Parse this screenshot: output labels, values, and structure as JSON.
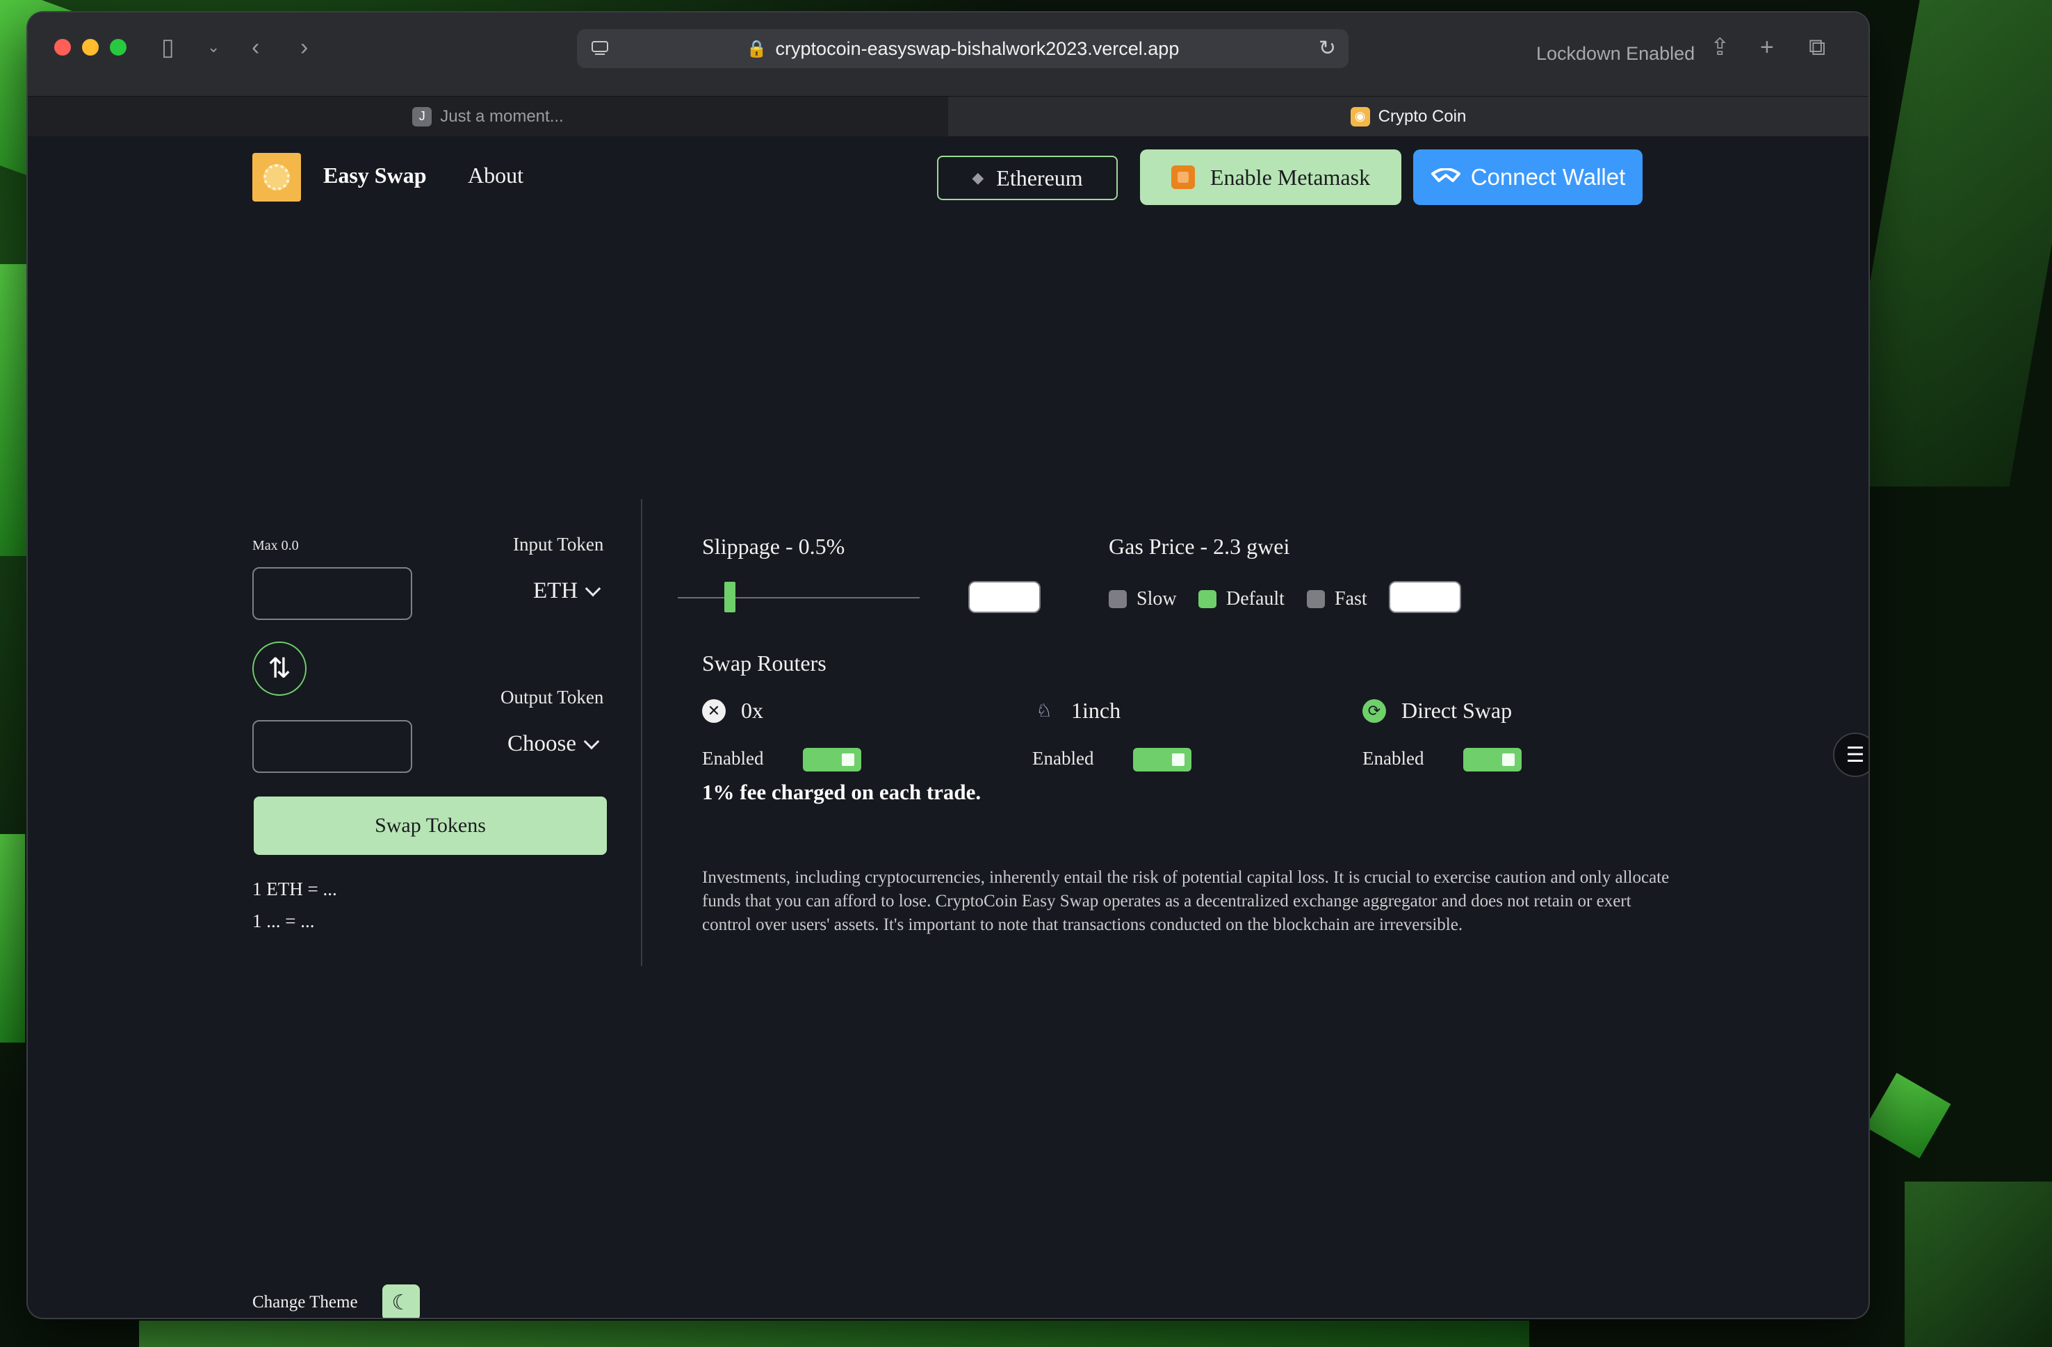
{
  "browser": {
    "url": "cryptocoin-easyswap-bishalwork2023.vercel.app",
    "lockdown": "Lockdown Enabled",
    "tabs": [
      {
        "label": "Just a moment...",
        "favicon": "J"
      },
      {
        "label": "Crypto Coin"
      }
    ]
  },
  "nav": {
    "brand": "Easy Swap",
    "about": "About",
    "network_button": "Ethereum",
    "metamask_button": "Enable Metamask",
    "wallet_button": "Connect Wallet"
  },
  "swap": {
    "max_label": "Max 0.0",
    "input_token_label": "Input Token",
    "input_token_value": "ETH",
    "output_token_label": "Output Token",
    "output_token_value": "Choose",
    "swap_button": "Swap Tokens",
    "rate_line_1": "1 ETH = ...",
    "rate_line_2": "1 ... = ..."
  },
  "settings": {
    "slippage_label": "Slippage - 0.5%",
    "slippage_value": 0.5,
    "gas_label": "Gas Price - 2.3 gwei",
    "gas_options": [
      {
        "label": "Slow",
        "checked": false
      },
      {
        "label": "Default",
        "checked": true
      },
      {
        "label": "Fast",
        "checked": false
      }
    ],
    "routers_heading": "Swap Routers",
    "routers": [
      {
        "name": "0x",
        "status": "Enabled",
        "enabled": true
      },
      {
        "name": "1inch",
        "status": "Enabled",
        "enabled": true
      },
      {
        "name": "Direct Swap",
        "status": "Enabled",
        "enabled": true
      }
    ],
    "fee_note": "1% fee charged on each trade.",
    "disclaimer": "Investments, including cryptocurrencies, inherently entail the risk of potential capital loss. It is crucial to exercise caution and only allocate funds that you can afford to lose. CryptoCoin Easy Swap operates as a decentralized exchange aggregator and does not retain or exert control over users' assets. It's important to note that transactions conducted on the blockchain are irreversible."
  },
  "footer": {
    "theme_label": "Change Theme"
  },
  "colors": {
    "accent_green": "#6fcf6a",
    "button_green": "#b7e4b4",
    "wallet_blue": "#3b99fc",
    "logo_orange": "#f4b84a",
    "background": "#16191f"
  }
}
